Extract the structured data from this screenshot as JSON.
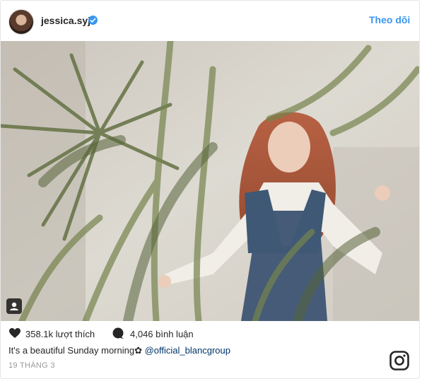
{
  "header": {
    "username": "jessica.syj",
    "follow_label": "Theo dõi"
  },
  "post": {
    "likes_label": "358.1k lượt thích",
    "comments_label": "4,046 bình luận",
    "caption_text": "It's a beautiful Sunday morning✿",
    "caption_mention": "@official_blancgroup",
    "date": "19 THÁNG 3"
  },
  "icons": {
    "verified": "verified-badge-icon",
    "tagged": "tagged-user-icon",
    "like": "heart-icon",
    "comment": "comment-bubble-icon",
    "brand": "instagram-icon"
  },
  "colors": {
    "link": "#3897f0",
    "mention": "#003569",
    "text": "#262626",
    "muted": "#999999"
  }
}
